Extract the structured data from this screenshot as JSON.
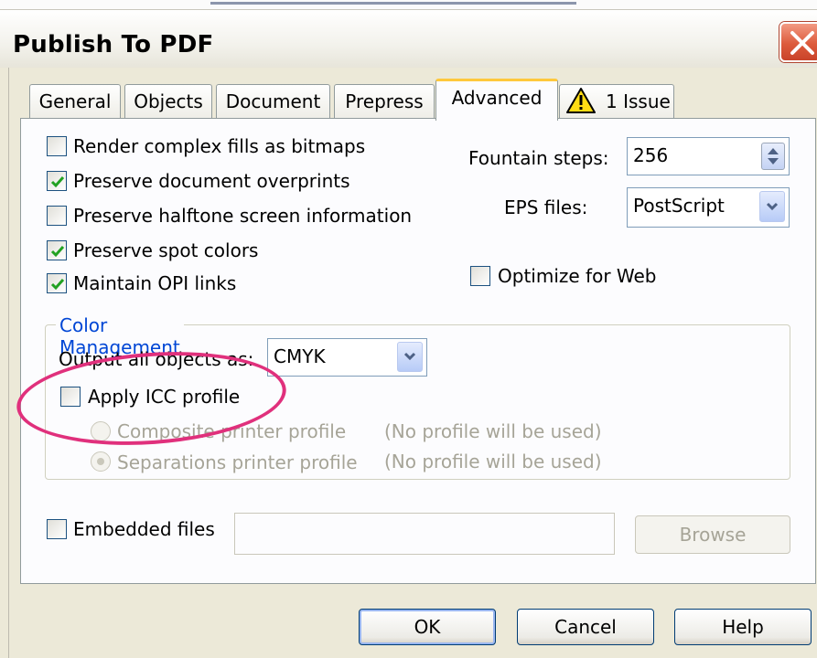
{
  "window": {
    "title": "Publish To PDF"
  },
  "tabs": [
    {
      "label": "General"
    },
    {
      "label": "Objects"
    },
    {
      "label": "Document"
    },
    {
      "label": "Prepress"
    },
    {
      "label": "Advanced",
      "active": true
    },
    {
      "label": "1 Issue",
      "icon": "warning-icon"
    }
  ],
  "options": {
    "render_complex_fills": {
      "label": "Render complex fills as bitmaps",
      "checked": false
    },
    "preserve_overprints": {
      "label": "Preserve document overprints",
      "checked": true
    },
    "preserve_halftone": {
      "label": "Preserve halftone screen information",
      "checked": false
    },
    "preserve_spot_colors": {
      "label": "Preserve spot colors",
      "checked": true
    },
    "maintain_opi": {
      "label": "Maintain OPI links",
      "checked": true
    },
    "optimize_web": {
      "label": "Optimize for Web",
      "checked": false
    }
  },
  "fountain_steps": {
    "label": "Fountain steps:",
    "value": "256"
  },
  "eps_files": {
    "label": "EPS files:",
    "value": "PostScript"
  },
  "color_management": {
    "legend": "Color Management",
    "output_label": "Output all objects as:",
    "output_value": "CMYK",
    "apply_icc": {
      "label": "Apply ICC profile",
      "checked": false
    },
    "composite": {
      "label": "Composite printer profile",
      "note": "(No profile will be used)",
      "selected": false
    },
    "separations": {
      "label": "Separations printer profile",
      "note": "(No profile will be used)",
      "selected": true
    }
  },
  "embedded_files": {
    "label": "Embedded files",
    "checked": false,
    "value": ""
  },
  "buttons": {
    "browse": "Browse",
    "ok": "OK",
    "cancel": "Cancel",
    "help": "Help"
  },
  "colors": {
    "highlight": "#e0307c",
    "tab_accent": "#ffc83c",
    "checkbox_mark": "#21a121",
    "legend_text": "#0046d5"
  }
}
